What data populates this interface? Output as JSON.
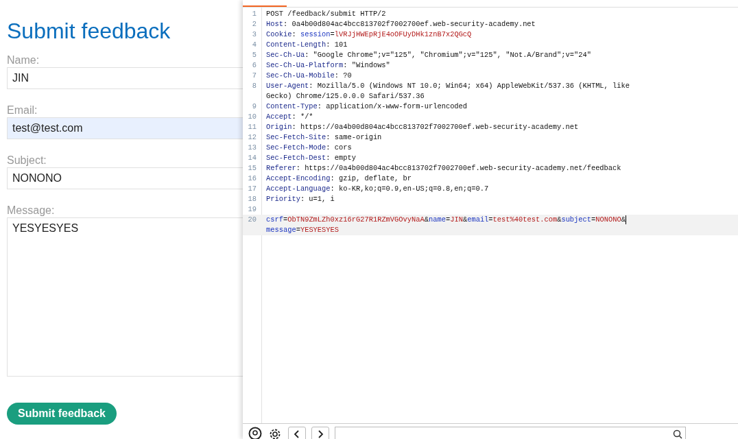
{
  "form": {
    "title": "Submit feedback",
    "fields": [
      {
        "label": "Name:",
        "value": "JIN",
        "kind": "text",
        "autofilled": false
      },
      {
        "label": "Email:",
        "value": "test@test.com",
        "kind": "text",
        "autofilled": true
      },
      {
        "label": "Subject:",
        "value": "NONONO",
        "kind": "text",
        "autofilled": false
      },
      {
        "label": "Message:",
        "value": "YESYESYES",
        "kind": "area",
        "autofilled": false
      }
    ],
    "submit": "Submit feedback"
  },
  "request": {
    "lines": [
      {
        "num": "1",
        "current": false,
        "rows": [
          {
            "segments": [
              {
                "kind": "plain",
                "text": "POST /feedback/submit HTTP/2"
              }
            ]
          }
        ]
      },
      {
        "num": "2",
        "current": false,
        "rows": [
          {
            "segments": [
              {
                "kind": "header",
                "text": "Host"
              },
              {
                "kind": "plain",
                "text": ": 0a4b00d804ac4bcc813702f7002700ef.web-security-academy.net"
              }
            ]
          }
        ]
      },
      {
        "num": "3",
        "current": false,
        "rows": [
          {
            "segments": [
              {
                "kind": "header",
                "text": "Cookie"
              },
              {
                "kind": "plain",
                "text": ": "
              },
              {
                "kind": "param",
                "text": "session"
              },
              {
                "kind": "plain",
                "text": "="
              },
              {
                "kind": "value",
                "text": "lVRJjHWEpRjE4oOFUyDHk1znB7x2QGcQ"
              }
            ]
          }
        ]
      },
      {
        "num": "4",
        "current": false,
        "rows": [
          {
            "segments": [
              {
                "kind": "header",
                "text": "Content-Length"
              },
              {
                "kind": "plain",
                "text": ": 101"
              }
            ]
          }
        ]
      },
      {
        "num": "5",
        "current": false,
        "rows": [
          {
            "segments": [
              {
                "kind": "header",
                "text": "Sec-Ch-Ua"
              },
              {
                "kind": "plain",
                "text": ": \"Google Chrome\";v=\"125\", \"Chromium\";v=\"125\", \"Not.A/Brand\";v=\"24\""
              }
            ]
          }
        ]
      },
      {
        "num": "6",
        "current": false,
        "rows": [
          {
            "segments": [
              {
                "kind": "header",
                "text": "Sec-Ch-Ua-Platform"
              },
              {
                "kind": "plain",
                "text": ": \"Windows\""
              }
            ]
          }
        ]
      },
      {
        "num": "7",
        "current": false,
        "rows": [
          {
            "segments": [
              {
                "kind": "header",
                "text": "Sec-Ch-Ua-Mobile"
              },
              {
                "kind": "plain",
                "text": ": ?0"
              }
            ]
          }
        ]
      },
      {
        "num": "8",
        "current": false,
        "rows": [
          {
            "segments": [
              {
                "kind": "header",
                "text": "User-Agent"
              },
              {
                "kind": "plain",
                "text": ": Mozilla/5.0 (Windows NT 10.0; Win64; x64) AppleWebKit/537.36 (KHTML, like"
              }
            ]
          },
          {
            "segments": [
              {
                "kind": "plain",
                "text": "Gecko) Chrome/125.0.0.0 Safari/537.36"
              }
            ]
          }
        ]
      },
      {
        "num": "9",
        "current": false,
        "rows": [
          {
            "segments": [
              {
                "kind": "header",
                "text": "Content-Type"
              },
              {
                "kind": "plain",
                "text": ": application/x-www-form-urlencoded"
              }
            ]
          }
        ]
      },
      {
        "num": "10",
        "current": false,
        "rows": [
          {
            "segments": [
              {
                "kind": "header",
                "text": "Accept"
              },
              {
                "kind": "plain",
                "text": ": */*"
              }
            ]
          }
        ]
      },
      {
        "num": "11",
        "current": false,
        "rows": [
          {
            "segments": [
              {
                "kind": "header",
                "text": "Origin"
              },
              {
                "kind": "plain",
                "text": ": https://0a4b00d804ac4bcc813702f7002700ef.web-security-academy.net"
              }
            ]
          }
        ]
      },
      {
        "num": "12",
        "current": false,
        "rows": [
          {
            "segments": [
              {
                "kind": "header",
                "text": "Sec-Fetch-Site"
              },
              {
                "kind": "plain",
                "text": ": same-origin"
              }
            ]
          }
        ]
      },
      {
        "num": "13",
        "current": false,
        "rows": [
          {
            "segments": [
              {
                "kind": "header",
                "text": "Sec-Fetch-Mode"
              },
              {
                "kind": "plain",
                "text": ": cors"
              }
            ]
          }
        ]
      },
      {
        "num": "14",
        "current": false,
        "rows": [
          {
            "segments": [
              {
                "kind": "header",
                "text": "Sec-Fetch-Dest"
              },
              {
                "kind": "plain",
                "text": ": empty"
              }
            ]
          }
        ]
      },
      {
        "num": "15",
        "current": false,
        "rows": [
          {
            "segments": [
              {
                "kind": "header",
                "text": "Referer"
              },
              {
                "kind": "plain",
                "text": ": https://0a4b00d804ac4bcc813702f7002700ef.web-security-academy.net/feedback"
              }
            ]
          }
        ]
      },
      {
        "num": "16",
        "current": false,
        "rows": [
          {
            "segments": [
              {
                "kind": "header",
                "text": "Accept-Encoding"
              },
              {
                "kind": "plain",
                "text": ": gzip, deflate, br"
              }
            ]
          }
        ]
      },
      {
        "num": "17",
        "current": false,
        "rows": [
          {
            "segments": [
              {
                "kind": "header",
                "text": "Accept-Language"
              },
              {
                "kind": "plain",
                "text": ": ko-KR,ko;q=0.9,en-US;q=0.8,en;q=0.7"
              }
            ]
          }
        ]
      },
      {
        "num": "18",
        "current": false,
        "rows": [
          {
            "segments": [
              {
                "kind": "header",
                "text": "Priority"
              },
              {
                "kind": "plain",
                "text": ": u=1, i"
              }
            ]
          }
        ]
      },
      {
        "num": "19",
        "current": false
      },
      {
        "num": "20",
        "current": true,
        "rows": [
          {
            "segments": [
              {
                "kind": "param",
                "text": "csrf"
              },
              {
                "kind": "plain",
                "text": "="
              },
              {
                "kind": "value",
                "text": "ObTN9ZmLZh0xz16rG27R1RZmVGOvyNaA"
              },
              {
                "kind": "plain",
                "text": "&"
              },
              {
                "kind": "param",
                "text": "name"
              },
              {
                "kind": "plain",
                "text": "="
              },
              {
                "kind": "value",
                "text": "JIN"
              },
              {
                "kind": "plain",
                "text": "&"
              },
              {
                "kind": "param",
                "text": "email"
              },
              {
                "kind": "plain",
                "text": "="
              },
              {
                "kind": "value",
                "text": "test%40test.com"
              },
              {
                "kind": "plain",
                "text": "&"
              },
              {
                "kind": "param",
                "text": "subject"
              },
              {
                "kind": "plain",
                "text": "="
              },
              {
                "kind": "value",
                "text": "NONONO"
              },
              {
                "kind": "plain",
                "text": "&"
              }
            ]
          },
          {
            "segments": [
              {
                "kind": "param",
                "text": "message"
              },
              {
                "kind": "plain",
                "text": "="
              },
              {
                "kind": "value",
                "text": "YESYESYES"
              }
            ]
          }
        ]
      }
    ]
  }
}
